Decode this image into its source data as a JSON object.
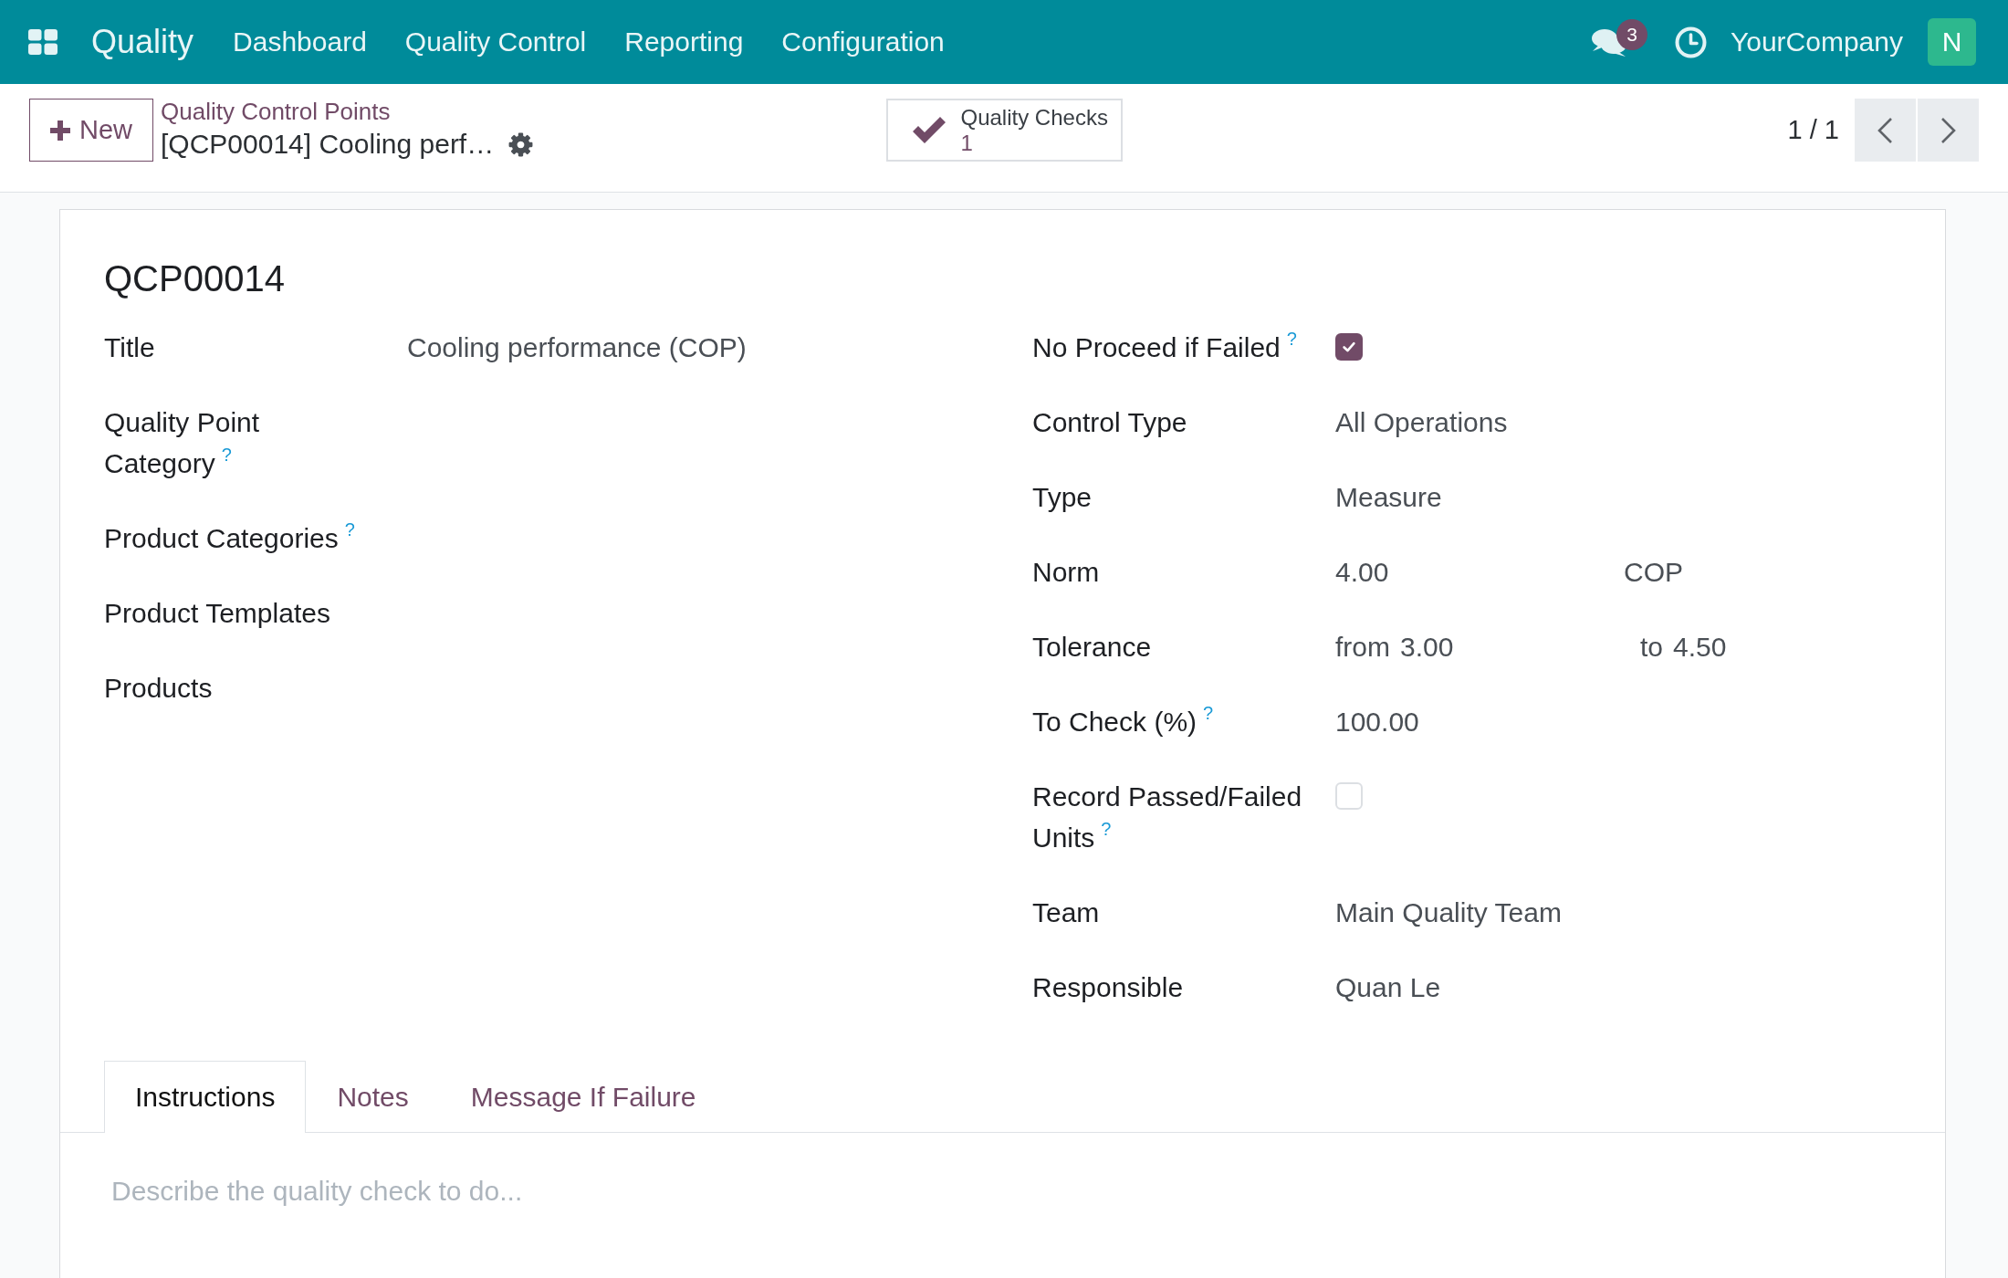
{
  "navbar": {
    "app_name": "Quality",
    "menu": [
      {
        "label": "Dashboard"
      },
      {
        "label": "Quality Control"
      },
      {
        "label": "Reporting"
      },
      {
        "label": "Configuration"
      }
    ],
    "messages_count": "3",
    "company": "YourCompany",
    "user_initial": "N"
  },
  "control_panel": {
    "new_button": "New",
    "breadcrumb": [
      {
        "label": "Quality Control Points"
      },
      {
        "label": "[QCP00014] Cooling perf…"
      }
    ],
    "stat_button": {
      "label": "Quality Checks",
      "count": "1"
    },
    "pager": "1 / 1"
  },
  "sheet": {
    "reference": "QCP00014",
    "left_fields": [
      {
        "kind": "text",
        "label": "Title",
        "value": "Cooling performance (COP)"
      },
      {
        "kind": "text",
        "label": "Quality Point Category$^{?}$"
      },
      {
        "kind": "text",
        "label": "Product Categories$^{?}$"
      },
      {
        "kind": "text",
        "label": "Product Templates"
      },
      {
        "kind": "text",
        "label": "Products"
      }
    ],
    "right_fields": [
      {
        "kind": "checkbox",
        "label": "No Proceed if Failed$^{?}$",
        "checked": true
      },
      {
        "kind": "text",
        "label": "Control Type",
        "value": "All Operations"
      },
      {
        "kind": "text",
        "label": "Type",
        "value": "Measure"
      },
      {
        "kind": "measure",
        "label": "Norm",
        "value": "4.00",
        "unit": "COP"
      },
      {
        "kind": "range",
        "label": "Tolerance",
        "from_label": "from",
        "from": "3.00",
        "to_label": "to",
        "to": "4.50"
      },
      {
        "kind": "text",
        "label": "To Check (%)$^{?}$",
        "value": "100.00"
      },
      {
        "kind": "checkbox",
        "label": "Record Passed/Failed Units$^{?}$",
        "checked": false
      },
      {
        "kind": "text",
        "label": "Team",
        "value": "Main Quality Team"
      },
      {
        "kind": "text",
        "label": "Responsible",
        "value": "Quan Le"
      }
    ]
  },
  "notebook": {
    "tabs": [
      {
        "label": "Instructions",
        "selected": true
      },
      {
        "label": "Notes",
        "selected": false
      },
      {
        "label": "Message If Failure",
        "selected": false
      }
    ],
    "placeholder": "Describe the quality check to do..."
  }
}
